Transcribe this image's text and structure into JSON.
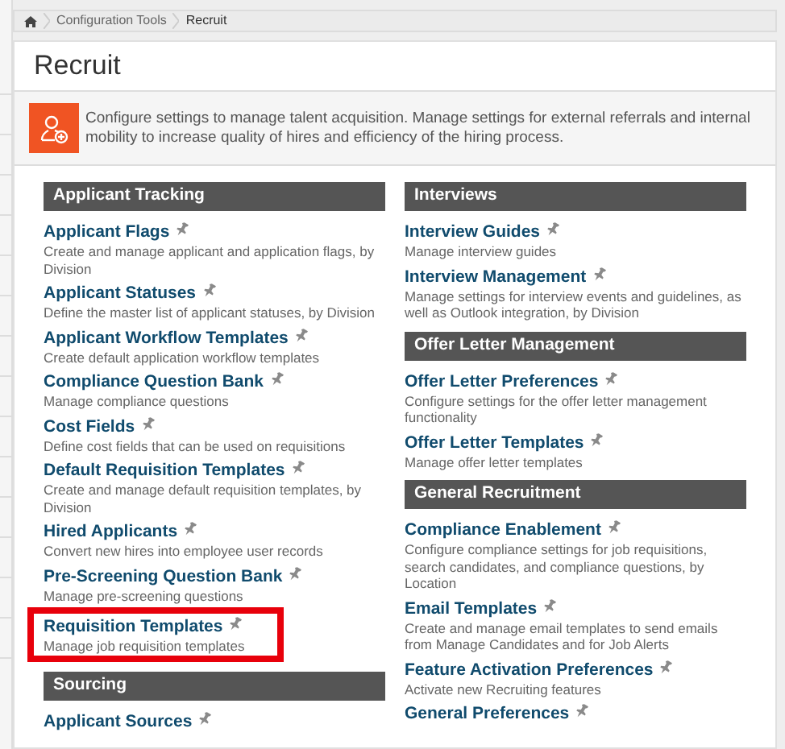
{
  "breadcrumb": [
    "Configuration Tools",
    "Recruit"
  ],
  "page_title": "Recruit",
  "description": "Configure settings to manage talent acquisition. Manage settings for external referrals and internal mobility to increase quality of hires and efficiency of the hiring process.",
  "columns": [
    [
      {
        "title": "Applicant Tracking",
        "items": [
          {
            "name": "Applicant Flags",
            "desc": "Create and manage applicant and application flags, by Division",
            "highlighted": false
          },
          {
            "name": "Applicant Statuses",
            "desc": "Define the master list of applicant statuses, by Division",
            "highlighted": false
          },
          {
            "name": "Applicant Workflow Templates",
            "desc": "Create default application workflow templates",
            "highlighted": false
          },
          {
            "name": "Compliance Question Bank",
            "desc": "Manage compliance questions",
            "highlighted": false
          },
          {
            "name": "Cost Fields",
            "desc": "Define cost fields that can be used on requisitions",
            "highlighted": false
          },
          {
            "name": "Default Requisition Templates",
            "desc": "Create and manage default requisition templates, by Division",
            "highlighted": false
          },
          {
            "name": "Hired Applicants",
            "desc": "Convert new hires into employee user records",
            "highlighted": false
          },
          {
            "name": "Pre-Screening Question Bank",
            "desc": "Manage pre-screening questions",
            "highlighted": false
          },
          {
            "name": "Requisition Templates",
            "desc": "Manage job requisition templates",
            "highlighted": true
          }
        ]
      },
      {
        "title": "Sourcing",
        "items": [
          {
            "name": "Applicant Sources",
            "highlighted": false
          }
        ]
      }
    ],
    [
      {
        "title": "Interviews",
        "items": [
          {
            "name": "Interview Guides",
            "desc": "Manage interview guides",
            "highlighted": false
          },
          {
            "name": "Interview Management",
            "desc": "Manage settings for interview events and guidelines, as well as Outlook integration, by Division",
            "highlighted": false
          }
        ]
      },
      {
        "title": "Offer Letter Management",
        "items": [
          {
            "name": "Offer Letter Preferences",
            "desc": "Configure settings for the offer letter management functionality",
            "highlighted": false
          },
          {
            "name": "Offer Letter Templates",
            "desc": "Manage offer letter templates",
            "highlighted": false
          }
        ]
      },
      {
        "title": "General Recruitment",
        "items": [
          {
            "name": "Compliance Enablement",
            "desc": "Configure compliance settings for job requisitions, search candidates, and compliance questions, by Location",
            "highlighted": false
          },
          {
            "name": "Email Templates",
            "desc": "Create and manage email templates to send emails from Manage Candidates and for Job Alerts",
            "highlighted": false
          },
          {
            "name": "Feature Activation Preferences",
            "desc": "Activate new Recruiting features",
            "highlighted": false
          },
          {
            "name": "General Preferences",
            "highlighted": false
          }
        ]
      }
    ]
  ]
}
